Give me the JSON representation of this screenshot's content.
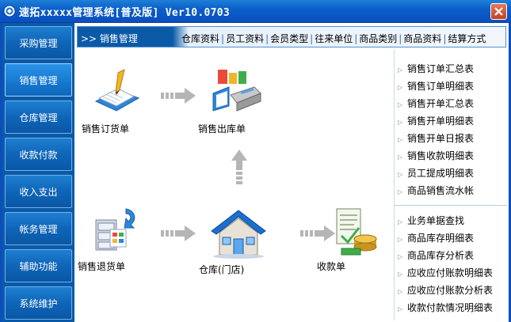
{
  "window": {
    "title": "速拓xxxxx管理系统[普及版] Ver10.0703"
  },
  "sidebar": {
    "items": [
      {
        "label": "采购管理"
      },
      {
        "label": "销售管理"
      },
      {
        "label": "仓库管理"
      },
      {
        "label": "收款付款"
      },
      {
        "label": "收入支出"
      },
      {
        "label": "帐务管理"
      },
      {
        "label": "辅助功能"
      },
      {
        "label": "系统维护"
      }
    ]
  },
  "topbar": {
    "breadcrumb": ">> 销售管理",
    "links": [
      "仓库资料",
      "员工资料",
      "会员类型",
      "往来单位",
      "商品类别",
      "商品资料",
      "结算方式"
    ],
    "separator": "|"
  },
  "flow": {
    "sales_order": "销售订货单",
    "sales_outbound": "销售出库单",
    "sales_return": "销售退货单",
    "warehouse": "仓库(门店)",
    "receipt": "收款单"
  },
  "reports_top": [
    "销售订单汇总表",
    "销售订单明细表",
    "销售开单汇总表",
    "销售开单明细表",
    "销售开单日报表",
    "销售收款明细表",
    "员工提成明细表",
    "商品销售流水帐"
  ],
  "reports_bottom": [
    "业务单据查找",
    "商品库存明细表",
    "商品库存分析表",
    "应收应付账款明细表",
    "应收应付账款分析表",
    "收款付款情况明细表"
  ]
}
